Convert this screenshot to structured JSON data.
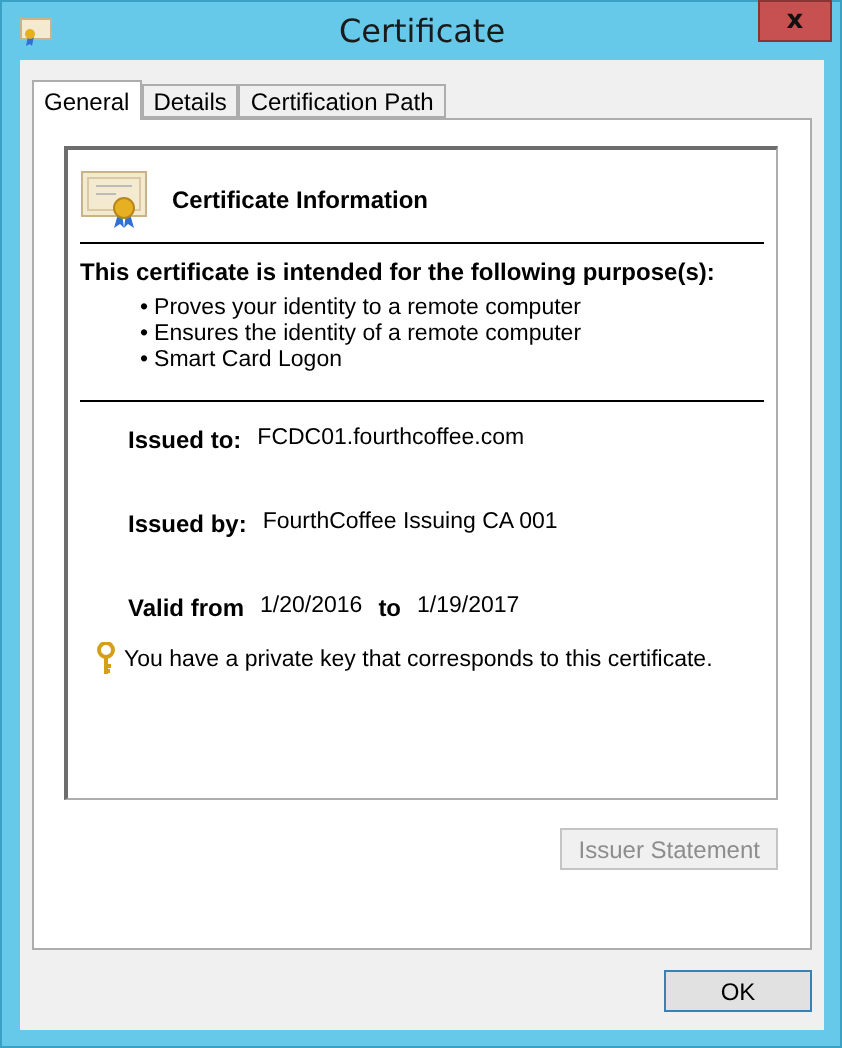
{
  "window": {
    "title": "Certificate",
    "close": "x"
  },
  "tabs": [
    {
      "label": "General",
      "selected": true
    },
    {
      "label": "Details",
      "selected": false
    },
    {
      "label": "Certification Path",
      "selected": false
    }
  ],
  "info": {
    "heading": "Certificate Information",
    "purpose_title": "This certificate is intended for the following purpose(s):",
    "purposes": [
      "Proves your identity to a remote computer",
      "Ensures the identity of a remote computer",
      "Smart Card Logon"
    ],
    "bullet": "•",
    "issued_to": {
      "label": "Issued to:",
      "value": "FCDC01.fourthcoffee.com"
    },
    "issued_by": {
      "label": "Issued by:",
      "value": "FourthCoffee Issuing CA 001"
    },
    "valid": {
      "from_label": "Valid from",
      "from": "1/20/2016",
      "to_label": "to",
      "to": "1/19/2017"
    },
    "key_note": "You have a private key that corresponds to this certificate."
  },
  "issuer_button": {
    "label": "Issuer Statement",
    "disabled": true
  },
  "ok_button": {
    "label": "OK"
  }
}
